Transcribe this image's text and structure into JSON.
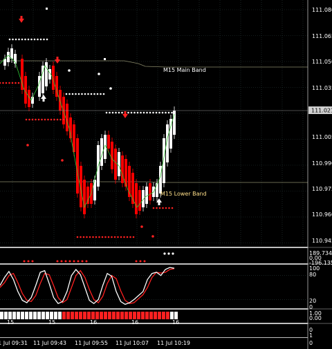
{
  "colors": {
    "background": "#000000",
    "grid": "#2b3a3a",
    "bear": "#ff0000",
    "bull": "#ffffff",
    "band": "#8a8a6a",
    "green_line": "#35c435",
    "main_band_label": "#ffffff",
    "lower_band_label": "#ffe08a",
    "stoch_main": "#ffffff",
    "stoch_signal": "#ff2020",
    "panel_border": "#c0c0c0"
  },
  "main_chart": {
    "price_axis": [
      "111.080",
      "111.065",
      "111.050",
      "111.035",
      "111.021",
      "111.005",
      "110.990",
      "110.975",
      "110.960",
      "110.945"
    ],
    "current_price": "111.021",
    "main_band_label": "M15 Main Band",
    "lower_band_label": "M15 Lower Band"
  },
  "indicator1": {
    "scale": [
      "189.7345",
      "0.00",
      "-196.1355"
    ]
  },
  "stochastic": {
    "scale": [
      "100",
      "80",
      "20",
      "0"
    ],
    "main_line": [
      55,
      75,
      90,
      70,
      40,
      18,
      12,
      25,
      55,
      88,
      92,
      60,
      25,
      10,
      15,
      40,
      80,
      95,
      82,
      50,
      18,
      10,
      20,
      55,
      85,
      78,
      40,
      15,
      8,
      12,
      20,
      30,
      40,
      70,
      85,
      88,
      80,
      95,
      100,
      98
    ],
    "signal_line": [
      50,
      62,
      80,
      85,
      62,
      35,
      18,
      15,
      30,
      60,
      85,
      82,
      55,
      25,
      12,
      20,
      50,
      80,
      92,
      75,
      45,
      20,
      12,
      28,
      60,
      80,
      72,
      42,
      18,
      10,
      12,
      22,
      32,
      50,
      75,
      88,
      86,
      88,
      95,
      97
    ]
  },
  "hist_panel": {
    "scale": [
      "1.00",
      "0.00"
    ],
    "period_labels": [
      "15",
      "15",
      "16",
      "16",
      "16"
    ]
  },
  "empty_panel": {
    "scale": [
      "0"
    ]
  },
  "time_axis": {
    "labels": [
      "11 Jul 09:31",
      "11 Jul 09:43",
      "11 Jul 09:55",
      "11 Jul 10:07",
      "11 Jul 10:19"
    ],
    "scale_top": "1",
    "scale_bottom": "0"
  }
}
